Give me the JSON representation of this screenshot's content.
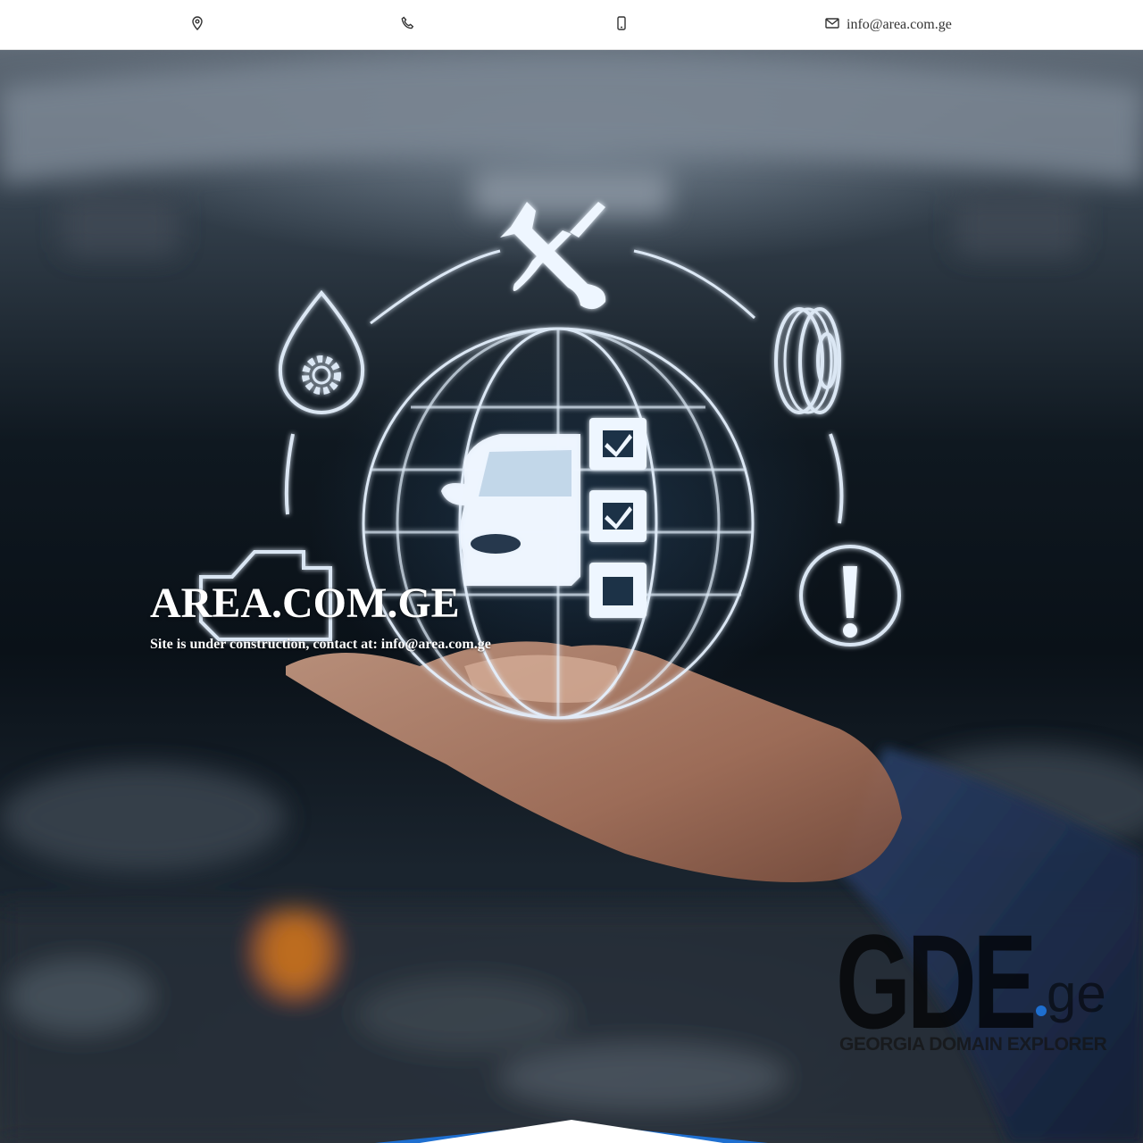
{
  "topbar": {
    "items": [
      {
        "icon": "map-pin-icon",
        "text": ""
      },
      {
        "icon": "phone-icon",
        "text": ""
      },
      {
        "icon": "mobile-phone-icon",
        "text": ""
      },
      {
        "icon": "envelope-icon",
        "text": "info@area.com.ge"
      }
    ]
  },
  "hero": {
    "title": "AREA.COM.GE",
    "subtitle": "Site is under construction, contact at: info@area.com.ge"
  },
  "watermark": {
    "brand": "GDE",
    "tld": "ge",
    "tagline": "GEORGIA DOMAIN EXPLORER"
  },
  "colors": {
    "topbar_bg": "#ffffff",
    "text_dark": "#333333",
    "hero_text": "#ffffff",
    "accent_blue": "#1e6fd0",
    "glow": "#dfeeff"
  }
}
